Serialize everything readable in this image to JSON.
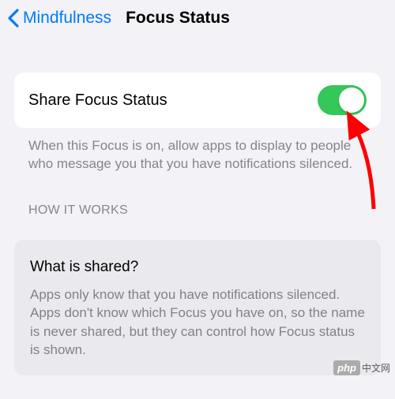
{
  "nav": {
    "back_label": "Mindfulness",
    "title": "Focus Status"
  },
  "setting": {
    "share_label": "Share Focus Status",
    "toggle_on": true,
    "description": "When this Focus is on, allow apps to display to people who message you that you have notifications silenced."
  },
  "section": {
    "header": "HOW IT WORKS"
  },
  "info": {
    "title": "What is shared?",
    "body": "Apps only know that you have notifications silenced. Apps don't know which Focus you have on, so the name is never shared, but they can control how Focus status is shown."
  },
  "watermark": {
    "brand": "php",
    "text": "中文网"
  },
  "colors": {
    "accent": "#007aff",
    "toggle_on": "#34c759",
    "bg": "#f2f2f7"
  }
}
